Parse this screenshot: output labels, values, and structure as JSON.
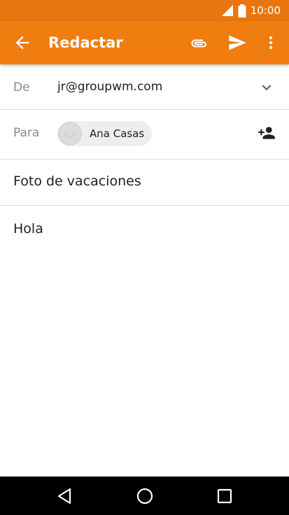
{
  "status_bar": {
    "time": "10:00"
  },
  "app_bar": {
    "title": "Redactar"
  },
  "from": {
    "label": "De",
    "value": "jr@groupwm.com"
  },
  "to": {
    "label": "Para",
    "recipients": [
      {
        "name": "Ana Casas"
      }
    ]
  },
  "subject": "Foto de vacaciones",
  "body": "Hola",
  "colors": {
    "app_bar": "#f07d0f",
    "status_bar": "#e8760f",
    "nav_bar": "#000000"
  },
  "icons": {
    "back": "arrow-back-icon",
    "attach": "paperclip-icon",
    "send": "send-icon",
    "more": "more-vert-icon",
    "expand": "chevron-down-icon",
    "add_contact": "person-add-icon",
    "nav_back": "triangle-back-icon",
    "nav_home": "circle-home-icon",
    "nav_recent": "square-recent-icon"
  }
}
